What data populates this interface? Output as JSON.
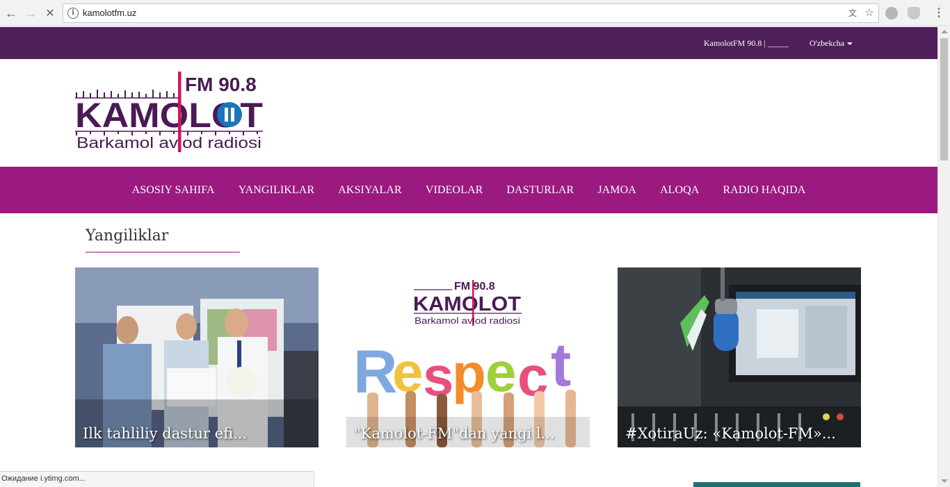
{
  "browser": {
    "url": "kamolotfm.uz",
    "status": "Ожидание i.ytimg.com..."
  },
  "topbar": {
    "station": "KamolotFM 90.8 | _____",
    "language": "O'zbekcha"
  },
  "logo": {
    "frequency": "FM 90.8",
    "name": "KAMOLOT",
    "tagline": "Barkamol avlod radiosi"
  },
  "nav": [
    {
      "label": "ASOSIY SAHIFA"
    },
    {
      "label": "YANGILIKLAR"
    },
    {
      "label": "AKSIYALAR"
    },
    {
      "label": "VIDEOLAR"
    },
    {
      "label": "DASTURLAR"
    },
    {
      "label": "JAMOA"
    },
    {
      "label": "ALOQA"
    },
    {
      "label": "RADIO HAQIDA"
    }
  ],
  "section": {
    "title": "Yangiliklar"
  },
  "news": [
    {
      "title": "Ilk tahliliy dastur efi..."
    },
    {
      "title": "\"Kamolot-FM\"dan yangi l..."
    },
    {
      "title": "#XotiraUz: «Kamolot-FM»..."
    }
  ],
  "colors": {
    "topbar": "#4f1f5a",
    "nav": "#9b1a7f",
    "logo_purple": "#4a1a55",
    "logo_pink": "#d4145a",
    "logo_blue": "#1b75bc"
  }
}
